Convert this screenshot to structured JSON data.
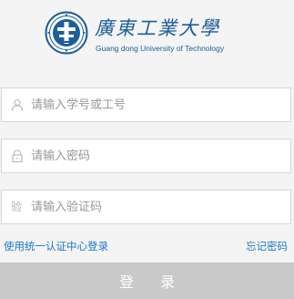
{
  "logo": {
    "cn_name": "廣東工業大學",
    "en_name": "Guang dong University of Technology"
  },
  "form": {
    "username_placeholder": "请输入学号或工号",
    "password_placeholder": "请输入密码",
    "captcha_placeholder": "请输入验证码",
    "captcha_icon_char": "验"
  },
  "links": {
    "unified_login": "使用统一认证中心登录",
    "forgot_password": "忘记密码"
  },
  "login_button_label": "登 录",
  "colors": {
    "brand_blue": "#1d5d9b",
    "link_blue": "#1e78c8",
    "button_gray": "#c9c9c9",
    "page_bg": "#f4f4f4"
  },
  "icons": {
    "seal": "university-seal-icon",
    "user": "user-icon",
    "lock": "lock-icon"
  }
}
